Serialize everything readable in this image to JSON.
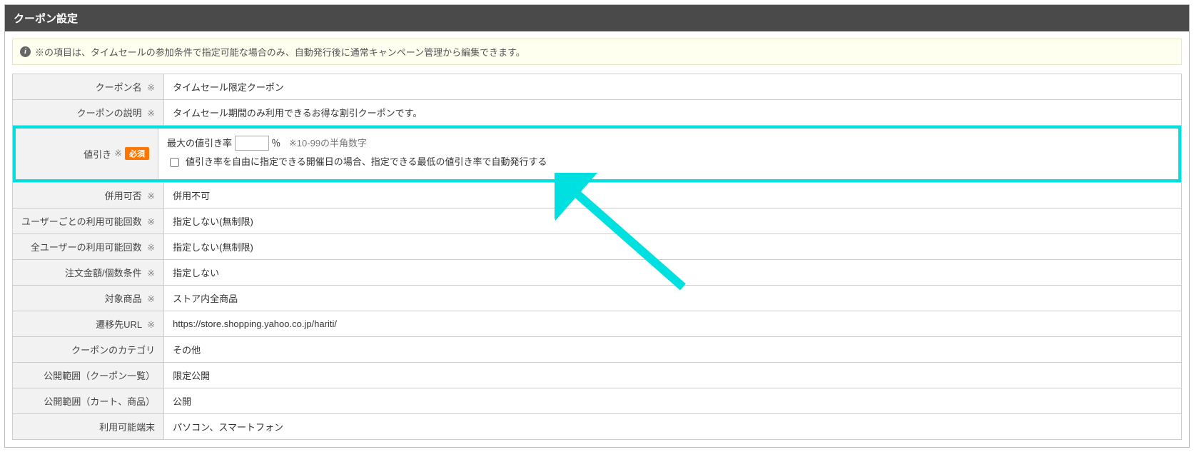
{
  "panel": {
    "title": "クーポン設定"
  },
  "info": {
    "text": "※の項目は、タイムセールの参加条件で指定可能な場合のみ、自動発行後に通常キャンペーン管理から編集できます。"
  },
  "labels": {
    "coupon_name": "クーポン名",
    "coupon_desc": "クーポンの説明",
    "discount": "値引き",
    "combinable": "併用可否",
    "per_user_limit": "ユーザーごとの利用可能回数",
    "all_user_limit": "全ユーザーの利用可能回数",
    "order_cond": "注文金額/個数条件",
    "target_items": "対象商品",
    "dest_url": "遷移先URL",
    "coupon_category": "クーポンのカテゴリ",
    "visibility_list": "公開範囲（クーポン一覧）",
    "visibility_cart": "公開範囲（カート、商品）",
    "device": "利用可能端末",
    "mark": "※",
    "required": "必須"
  },
  "values": {
    "coupon_name": "タイムセール限定クーポン",
    "coupon_desc": "タイムセール期間のみ利用できるお得な割引クーポンです。",
    "discount_prefix": "最大の値引き率",
    "discount_unit": "％",
    "discount_note": "※10-99の半角数字",
    "discount_value": "",
    "discount_checkbox": "値引き率を自由に指定できる開催日の場合、指定できる最低の値引き率で自動発行する",
    "combinable": "併用不可",
    "per_user_limit": "指定しない(無制限)",
    "all_user_limit": "指定しない(無制限)",
    "order_cond": "指定しない",
    "target_items": "ストア内全商品",
    "dest_url": "https://store.shopping.yahoo.co.jp/hariti/",
    "coupon_category": "その他",
    "visibility_list": "限定公開",
    "visibility_cart": "公開",
    "device": "パソコン、スマートフォン"
  },
  "annotation": {
    "highlight_color": "#00e0e0"
  }
}
